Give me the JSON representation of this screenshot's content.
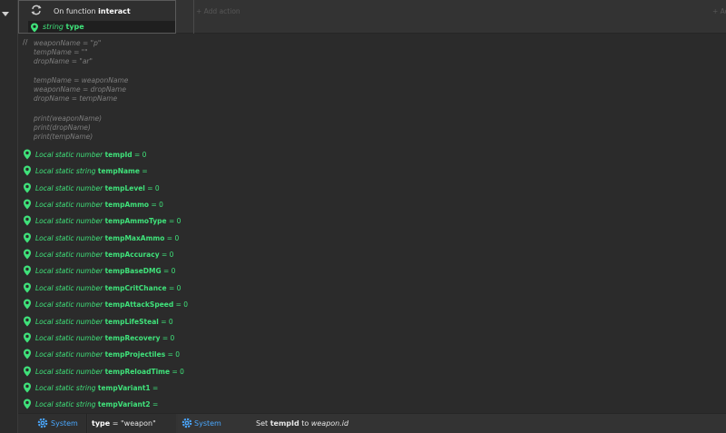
{
  "event": {
    "condition_prefix": "On function ",
    "condition_name": "interact",
    "param_type": "string",
    "param_name": "type",
    "add_action": "+ Add action",
    "add_right": "+ Add..."
  },
  "comment": {
    "marker": "//",
    "lines": [
      "weaponName = \"p\"",
      "tempName = \"\"",
      "dropName = \"ar\"",
      "",
      "tempName = weaponName",
      "weaponName = dropName",
      "dropName = tempName",
      "",
      "print(weaponName)",
      "print(dropName)",
      "print(tempName)"
    ]
  },
  "locals": [
    {
      "prefix": "Local static number",
      "name": "tempId",
      "value": "= 0"
    },
    {
      "prefix": "Local static string",
      "name": "tempName",
      "value": "="
    },
    {
      "prefix": "Local static number",
      "name": "tempLevel",
      "value": "= 0"
    },
    {
      "prefix": "Local static number",
      "name": "tempAmmo",
      "value": "= 0"
    },
    {
      "prefix": "Local static number",
      "name": "tempAmmoType",
      "value": "= 0"
    },
    {
      "prefix": "Local static number",
      "name": "tempMaxAmmo",
      "value": "= 0"
    },
    {
      "prefix": "Local static number",
      "name": "tempAccuracy",
      "value": "= 0"
    },
    {
      "prefix": "Local static number",
      "name": "tempBaseDMG",
      "value": "= 0"
    },
    {
      "prefix": "Local static number",
      "name": "tempCritChance",
      "value": "= 0"
    },
    {
      "prefix": "Local static number",
      "name": "tempAttackSpeed",
      "value": "= 0"
    },
    {
      "prefix": "Local static number",
      "name": "tempLifeSteal",
      "value": "= 0"
    },
    {
      "prefix": "Local static number",
      "name": "tempRecovery",
      "value": "= 0"
    },
    {
      "prefix": "Local static number",
      "name": "tempProjectiles",
      "value": "= 0"
    },
    {
      "prefix": "Local static number",
      "name": "tempReloadTime",
      "value": "= 0"
    },
    {
      "prefix": "Local static string",
      "name": "tempVariant1",
      "value": "="
    },
    {
      "prefix": "Local static string",
      "name": "tempVariant2",
      "value": "="
    }
  ],
  "subevent": {
    "system_label": "System",
    "condition_var": "type",
    "condition_rest": " = \"weapon\"",
    "action_system_label": "System",
    "action_prefix": "Set ",
    "action_var": "tempId",
    "action_mid": " to ",
    "action_value": "weapon.id"
  },
  "colors": {
    "background": "#2b2b2b",
    "local_green": "#3fe27a",
    "system_blue": "#4aa8ff",
    "comment_gray": "#7e7e7e"
  },
  "icons": {
    "function": "function-loop-icon",
    "local_var": "map-pin-icon",
    "system": "gear-icon"
  }
}
